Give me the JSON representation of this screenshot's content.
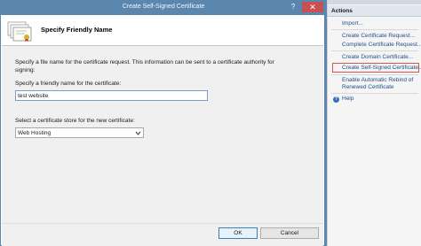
{
  "dialog": {
    "title": "Create Self-Signed Certificate",
    "help_glyph": "?",
    "close_glyph": "✕",
    "header_title": "Specify Friendly Name",
    "description": "Specify a file name for the certificate request.  This information can be sent to a certificate authority for signing:",
    "name_label": "Specify a friendly name for the certificate:",
    "name_value": "test website",
    "store_label": "Select a certificate store for the new certificate:",
    "store_value": "Web Hosting",
    "ok_label": "OK",
    "cancel_label": "Cancel"
  },
  "actions": {
    "header": "Actions",
    "items": [
      {
        "label": "Import..."
      },
      {
        "label": "Create Certificate Request..."
      },
      {
        "label": "Complete Certificate Request..."
      },
      {
        "label": "Create Domain Certificate..."
      },
      {
        "label": "Create Self-Signed Certificate..."
      },
      {
        "label": "Enable Automatic Rebind of"
      },
      {
        "label": "Renewed Certificate"
      },
      {
        "label": "Help"
      }
    ]
  },
  "colors": {
    "titlebar": "#5b86ad",
    "close_button": "#c75050",
    "link": "#1f4f86",
    "highlight_border": "#d9534f"
  },
  "icons": {
    "header": "certificate-icon",
    "help": "help-icon",
    "dropdown": "chevron-down-icon"
  }
}
